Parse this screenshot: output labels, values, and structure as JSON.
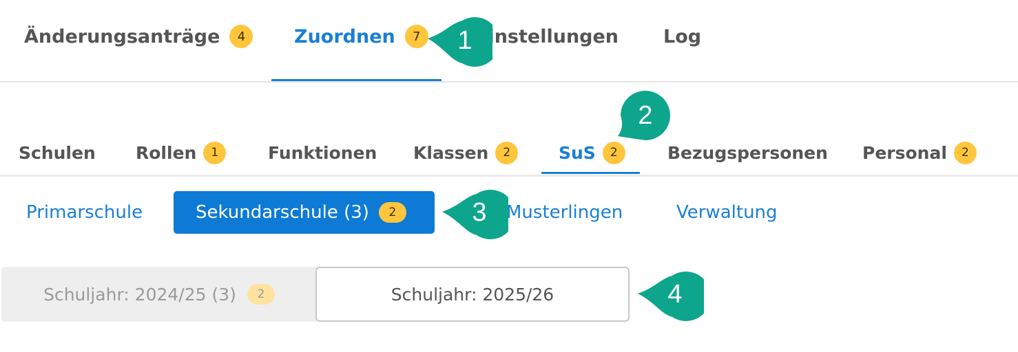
{
  "top_tabs": [
    {
      "label": "Änderungsanträge",
      "badge": "4"
    },
    {
      "label": "Zuordnen",
      "badge": "7",
      "active": true
    },
    {
      "label": "Einstellungen"
    },
    {
      "label": "Log"
    }
  ],
  "sub_tabs": [
    {
      "label": "Schulen"
    },
    {
      "label": "Rollen",
      "badge": "1"
    },
    {
      "label": "Funktionen"
    },
    {
      "label": "Klassen",
      "badge": "2"
    },
    {
      "label": "SuS",
      "badge": "2",
      "active": true
    },
    {
      "label": "Bezugspersonen"
    },
    {
      "label": "Personal",
      "badge": "2"
    }
  ],
  "schools": [
    {
      "label": "Primarschule"
    },
    {
      "label": "Sekundarschule (3)",
      "badge": "2",
      "active": true
    },
    {
      "label": "Musterlingen"
    },
    {
      "label": "Verwaltung"
    }
  ],
  "years": [
    {
      "label": "Schuljahr: 2024/25 (3)",
      "badge": "2"
    },
    {
      "label": "Schuljahr: 2025/26",
      "selected": true
    }
  ],
  "callouts": [
    "1",
    "2",
    "3",
    "4"
  ],
  "colors": {
    "accent": "#1a7fd4",
    "badge": "#ffc53d",
    "callout": "#0ea58d",
    "active_pill": "#0d7bd6"
  }
}
